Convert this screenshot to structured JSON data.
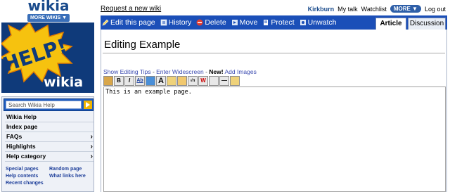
{
  "header": {
    "logo_text": "wikia",
    "more_wikis_label": "MORE WIKIS ▼",
    "request_link": "Request a new wiki",
    "user": {
      "username": "Kirkburn",
      "my_talk": "My talk",
      "watchlist": "Watchlist",
      "more_label": "MORE ▼",
      "logout": "Log out"
    }
  },
  "banner": {
    "help_text": "HELP!",
    "wikia_text": "wikia"
  },
  "sidebar": {
    "search_placeholder": "Search Wikia Help",
    "items": [
      {
        "label": "Wikia Help",
        "chevron": ""
      },
      {
        "label": "Index page",
        "chevron": ""
      },
      {
        "label": "FAQs",
        "chevron": "›"
      },
      {
        "label": "Highlights",
        "chevron": "›"
      },
      {
        "label": "Help category",
        "chevron": "›"
      }
    ],
    "links": {
      "special_pages": "Special pages",
      "random_page": "Random page",
      "help_contents": "Help contents",
      "what_links_here": "What links here",
      "recent_changes": "Recent changes"
    }
  },
  "actions": {
    "edit": "Edit this page",
    "history": "History",
    "delete": "Delete",
    "move": "Move",
    "protect": "Protect",
    "unwatch": "Unwatch"
  },
  "tabs": {
    "article": "Article",
    "discussion": "Discussion"
  },
  "page": {
    "title": "Editing Example",
    "show_tips": "Show Editing Tips",
    "sep1": " - ",
    "widescreen": "Enter Widescreen",
    "sep2": " - ",
    "new_label": "New!",
    "add_images": " Add Images"
  },
  "toolbar": {
    "buttons": [
      "bold-icon",
      "italic-icon",
      "link-icon",
      "external-link-icon",
      "headline-icon",
      "image-icon",
      "media-icon",
      "math-icon",
      "nowiki-icon",
      "signature-icon",
      "horizontal-line-icon",
      "redirect-icon"
    ],
    "labels": [
      "",
      "B",
      "I",
      "Ab",
      "",
      "A",
      "",
      "",
      "√n",
      "W",
      "",
      "—",
      ""
    ]
  },
  "editor": {
    "content": "This is an example page."
  },
  "colors": {
    "tabbar": "#1b4fb8",
    "link_blue": "#3a4ab0",
    "sidebar_bg": "#eef1f7"
  }
}
